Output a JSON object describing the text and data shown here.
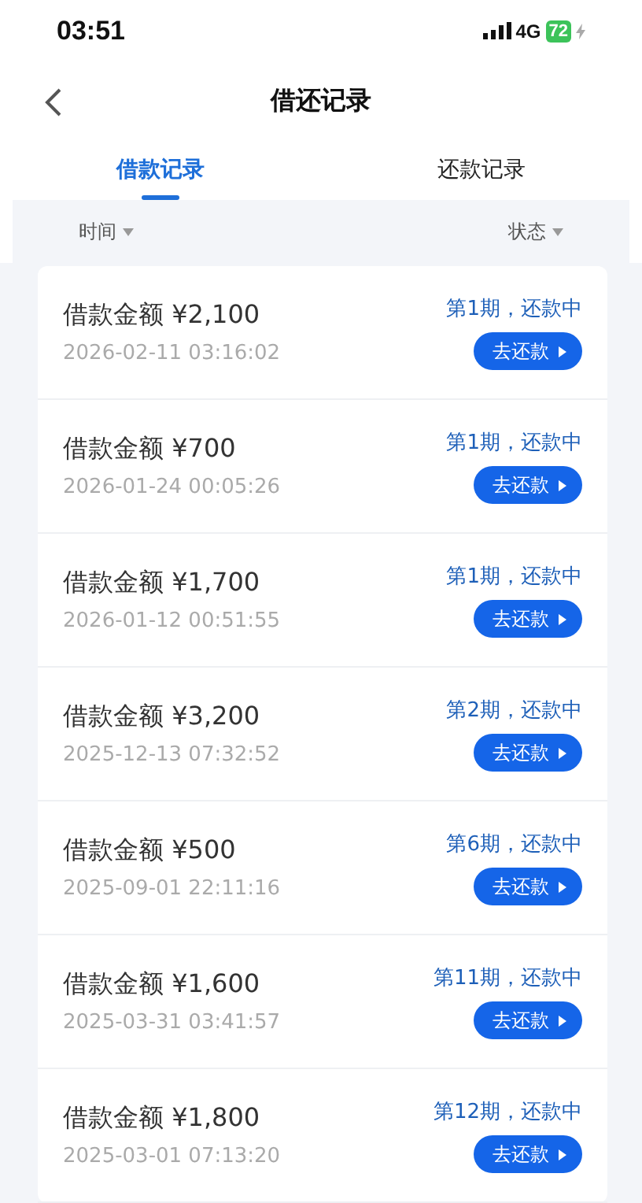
{
  "status_bar": {
    "time": "03:51",
    "network": "4G",
    "battery": "72"
  },
  "header": {
    "title": "借还记录"
  },
  "tabs": [
    {
      "label": "借款记录",
      "selected": true
    },
    {
      "label": "还款记录",
      "selected": false
    }
  ],
  "filters": [
    {
      "label": "时间"
    },
    {
      "label": "状态"
    }
  ],
  "loans": [
    {
      "amount": "借款金额 ¥2,100",
      "time": "2026-02-11 03:16:02",
      "status": "第1期，还款中",
      "action": "去还款"
    },
    {
      "amount": "借款金额 ¥700",
      "time": "2026-01-24 00:05:26",
      "status": "第1期，还款中",
      "action": "去还款"
    },
    {
      "amount": "借款金额 ¥1,700",
      "time": "2026-01-12 00:51:55",
      "status": "第1期，还款中",
      "action": "去还款"
    },
    {
      "amount": "借款金额 ¥3,200",
      "time": "2025-12-13 07:32:52",
      "status": "第2期，还款中",
      "action": "去还款"
    },
    {
      "amount": "借款金额 ¥500",
      "time": "2025-09-01 22:11:16",
      "status": "第6期，还款中",
      "action": "去还款"
    },
    {
      "amount": "借款金额 ¥1,600",
      "time": "2025-03-31 03:41:57",
      "status": "第11期，还款中",
      "action": "去还款"
    },
    {
      "amount": "借款金额 ¥1,800",
      "time": "2025-03-01 07:13:20",
      "status": "第12期，还款中",
      "action": "去还款"
    }
  ]
}
